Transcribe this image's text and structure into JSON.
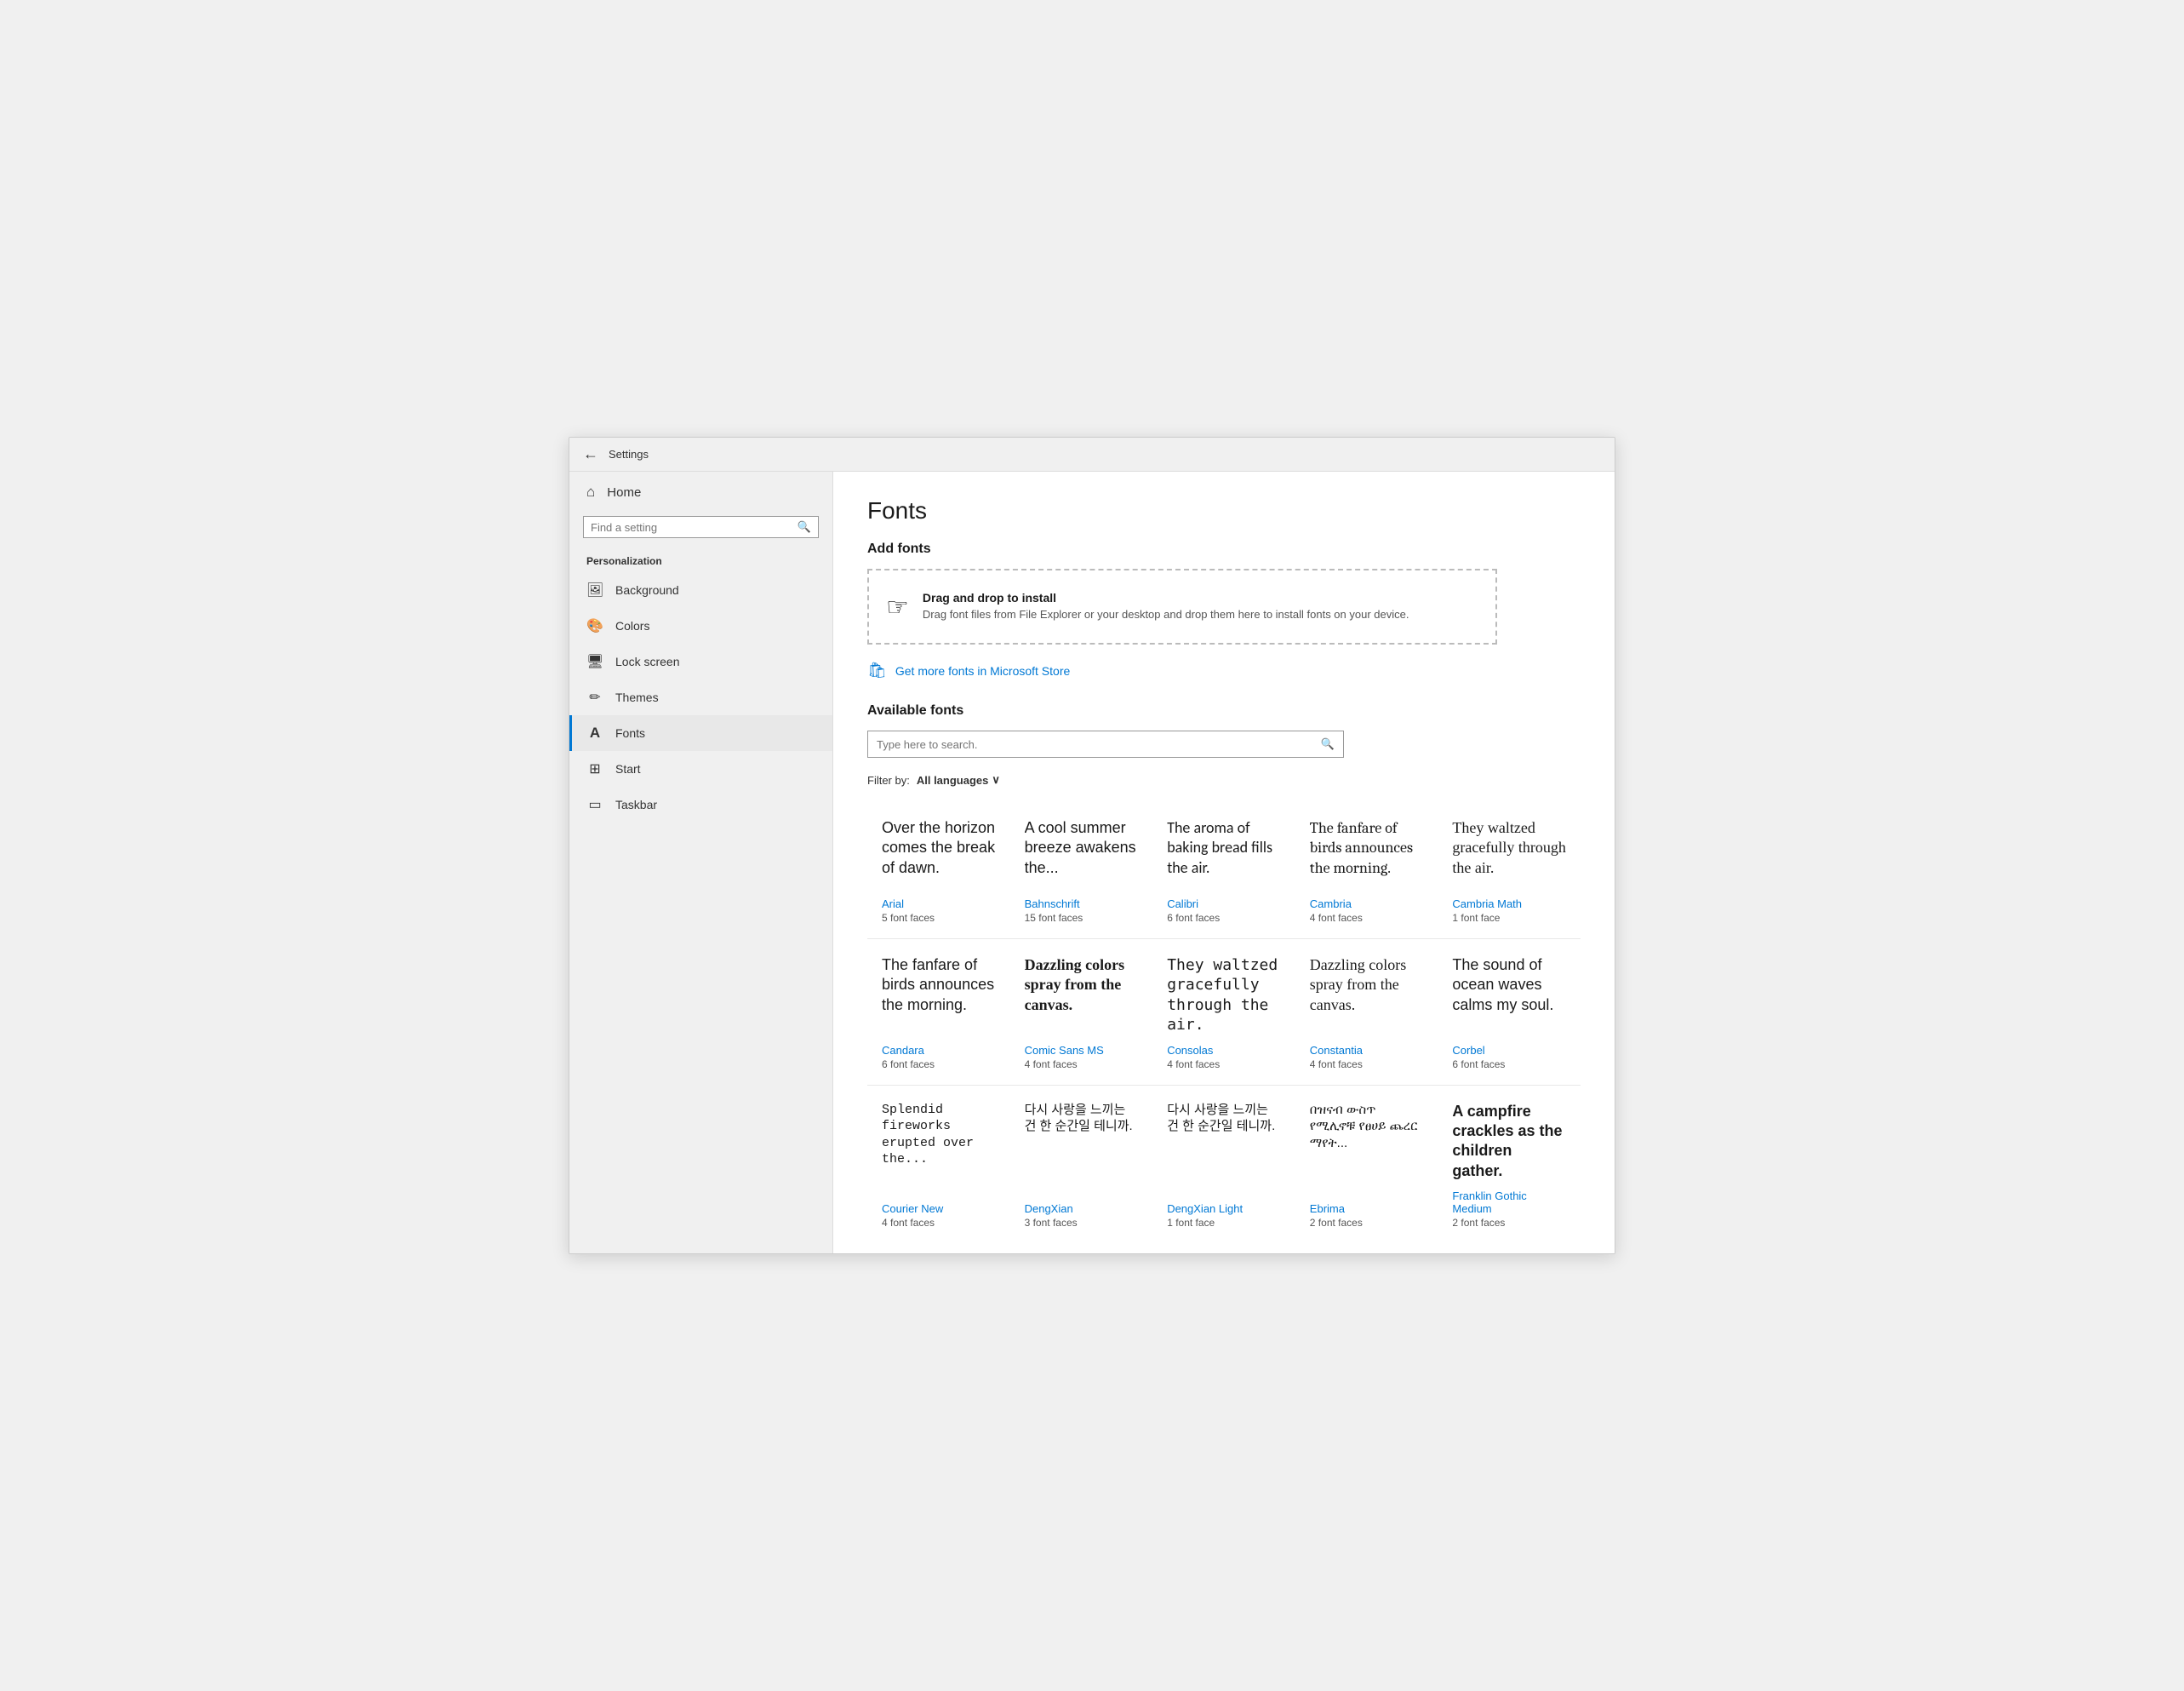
{
  "titlebar": {
    "back_label": "←",
    "title": "Settings"
  },
  "sidebar": {
    "home_label": "Home",
    "search_placeholder": "Find a setting",
    "section_title": "Personalization",
    "items": [
      {
        "id": "background",
        "label": "Background",
        "icon": "🖼"
      },
      {
        "id": "colors",
        "label": "Colors",
        "icon": "🎨"
      },
      {
        "id": "lock-screen",
        "label": "Lock screen",
        "icon": "🖥"
      },
      {
        "id": "themes",
        "label": "Themes",
        "icon": "✏"
      },
      {
        "id": "fonts",
        "label": "Fonts",
        "icon": "A",
        "active": true
      },
      {
        "id": "start",
        "label": "Start",
        "icon": "⊞"
      },
      {
        "id": "taskbar",
        "label": "Taskbar",
        "icon": "▭"
      }
    ]
  },
  "main": {
    "page_title": "Fonts",
    "add_fonts_section": "Add fonts",
    "drop_zone": {
      "cursor_icon": "☞",
      "main_text": "Drag and drop to install",
      "sub_text": "Drag font files from File Explorer or your desktop and drop them here to install fonts on your device."
    },
    "ms_store_link": "Get more fonts in Microsoft Store",
    "available_fonts_section": "Available fonts",
    "search_placeholder": "Type here to search.",
    "filter_label": "Filter by:",
    "filter_value": "All languages",
    "font_cards": [
      {
        "preview_text": "Over the horizon comes the break of dawn.",
        "font_family": "serif",
        "font_weight": "normal",
        "font_style": "normal",
        "name": "Arial",
        "faces": "5 font faces"
      },
      {
        "preview_text": "A cool summer breeze awakens the...",
        "font_family": "sans-serif",
        "font_weight": "normal",
        "font_style": "normal",
        "name": "Bahnschrift",
        "faces": "15 font faces"
      },
      {
        "preview_text": "The aroma of baking bread fills the air.",
        "font_family": "Calibri, sans-serif",
        "font_weight": "normal",
        "font_style": "normal",
        "name": "Calibri",
        "faces": "6 font faces"
      },
      {
        "preview_text": "The fanfare of birds announces the morning.",
        "font_family": "Cambria, Georgia, serif",
        "font_weight": "normal",
        "font_style": "normal",
        "name": "Cambria",
        "faces": "4 font faces"
      },
      {
        "preview_text": "They waltzed gracefully through the air.",
        "font_family": "Cambria Math, serif",
        "font_weight": "normal",
        "font_style": "normal",
        "name": "Cambria Math",
        "faces": "1 font face"
      },
      {
        "preview_text": "The fanfare of birds announces the morning.",
        "font_family": "Candara, sans-serif",
        "font_weight": "normal",
        "font_style": "normal",
        "name": "Candara",
        "faces": "6 font faces"
      },
      {
        "preview_text": "Dazzling colors spray from the canvas.",
        "font_family": "Comic Sans MS, cursive",
        "font_weight": "bold",
        "font_style": "normal",
        "name": "Comic Sans MS",
        "faces": "4 font faces"
      },
      {
        "preview_text": "They waltzed gracefully through the air.",
        "font_family": "Consolas, monospace",
        "font_weight": "normal",
        "font_style": "normal",
        "name": "Consolas",
        "faces": "4 font faces"
      },
      {
        "preview_text": "Dazzling colors spray from the canvas.",
        "font_family": "Constantia, serif",
        "font_weight": "normal",
        "font_style": "normal",
        "name": "Constantia",
        "faces": "4 font faces"
      },
      {
        "preview_text": "The sound of ocean waves calms my soul.",
        "font_family": "Corbel, sans-serif",
        "font_weight": "normal",
        "font_style": "normal",
        "name": "Corbel",
        "faces": "6 font faces"
      },
      {
        "preview_text": "Splendid fireworks erupted over the...",
        "font_family": "Courier New, monospace",
        "font_weight": "normal",
        "font_style": "normal",
        "name": "Courier New",
        "faces": "4 font faces"
      },
      {
        "preview_text": "다시 사랑을 느끼는 건 한 순간일 테니까.",
        "font_family": "sans-serif",
        "font_weight": "normal",
        "font_style": "normal",
        "name": "DengXian",
        "faces": "3 font faces"
      },
      {
        "preview_text": "다시 사랑을 느끼는 건 한 순간일 테니까.",
        "font_family": "sans-serif",
        "font_weight": "normal",
        "font_style": "normal",
        "name": "DengXian Light",
        "faces": "1 font face"
      },
      {
        "preview_text": "በዝናብ ውስጥ የሚሊኖቹ የፀሀይ ጨረር ማየት...",
        "font_family": "serif",
        "font_weight": "normal",
        "font_style": "normal",
        "name": "Ebrima",
        "faces": "2 font faces"
      },
      {
        "preview_text": "A campfire crackles as the children gather.",
        "font_family": "sans-serif",
        "font_weight": "bold",
        "font_style": "normal",
        "name": "Franklin Gothic Medium",
        "faces": "2 font faces"
      }
    ]
  }
}
